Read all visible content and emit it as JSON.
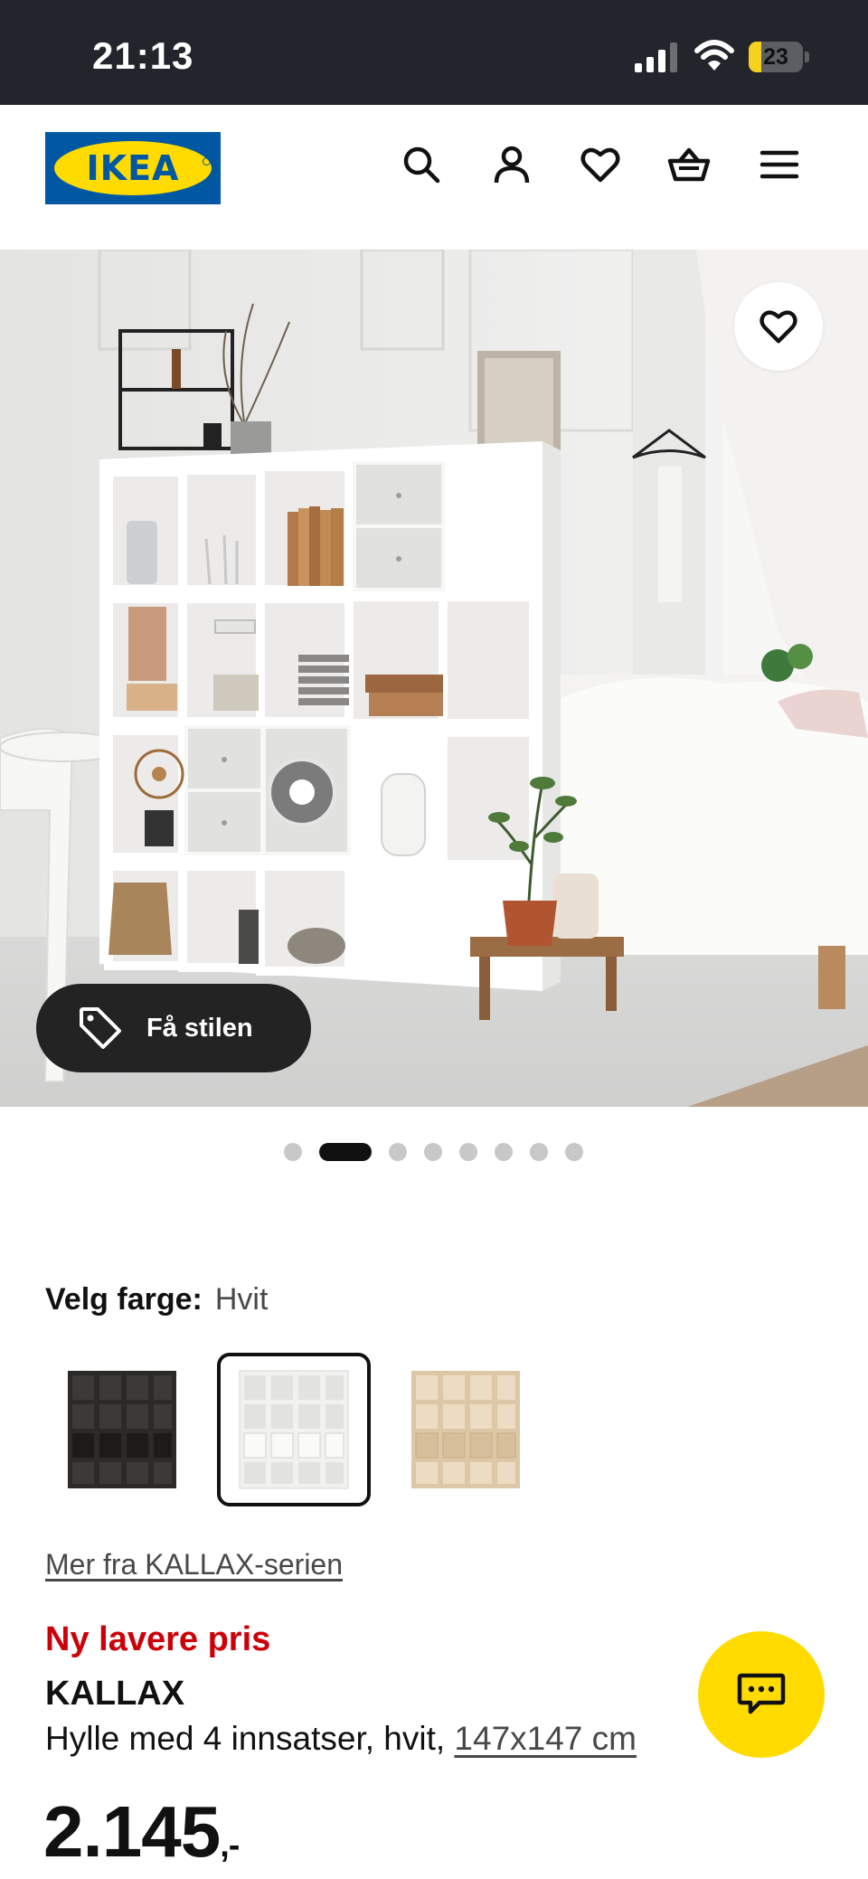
{
  "status_bar": {
    "time": "21:13",
    "battery_percent": "23",
    "battery_level": 0.23,
    "signal_icon": "cellular-signal-icon",
    "wifi_icon": "wifi-icon",
    "battery_icon": "battery-icon"
  },
  "header": {
    "logo_text": "IKEA",
    "icons": [
      "search-icon",
      "account-icon",
      "heart-icon",
      "shopping-basket-icon",
      "hamburger-menu-icon"
    ]
  },
  "hero": {
    "favorite_icon": "heart-icon",
    "style_button_label": "Få stilen",
    "style_button_icon": "tag-icon",
    "image_count": 8,
    "active_image": 2
  },
  "color_picker": {
    "label": "Velg farge:",
    "selected_value": "Hvit",
    "options": [
      {
        "name": "black-brown",
        "color": "#2b2a29"
      },
      {
        "name": "white",
        "color": "#f1f1ef"
      },
      {
        "name": "white-stained-oak",
        "color": "#dcc7a6"
      }
    ],
    "selected_index": 1
  },
  "series_link": "Mer fra KALLAX-serien",
  "product": {
    "price_badge": "Ny lavere pris",
    "name": "KALLAX",
    "description": "Hylle med 4 innsatser, hvit, ",
    "size": "147x147 cm",
    "price": "2.145",
    "price_suffix": ",-"
  },
  "chat": {
    "icon": "chat-icon"
  },
  "colors": {
    "brand_blue": "#0058a3",
    "brand_yellow": "#ffdb00",
    "price_red": "#cc0008",
    "status_bar_bg": "#22252b"
  }
}
